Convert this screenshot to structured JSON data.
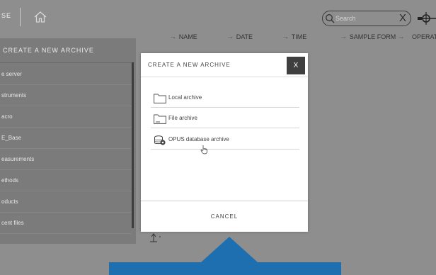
{
  "topbar": {
    "brand_fragment": "SE",
    "search_placeholder": "Search",
    "clear_label": "X"
  },
  "columns": [
    {
      "label": "NAME"
    },
    {
      "label": "DATE"
    },
    {
      "label": "TIME"
    },
    {
      "label": "SAMPLE FORM"
    },
    {
      "label": "OPERATI"
    }
  ],
  "panel": {
    "title": "CREATE A NEW ARCHIVE",
    "items": [
      {
        "label": "e server"
      },
      {
        "label": "struments"
      },
      {
        "label": "acro"
      },
      {
        "label": "E_Base"
      },
      {
        "label": "easurements"
      },
      {
        "label": "ethods"
      },
      {
        "label": "oducts"
      },
      {
        "label": "cent files"
      }
    ]
  },
  "modal": {
    "title": "CREATE A NEW ARCHIVE",
    "close_label": "X",
    "options": [
      {
        "label": "Local archive",
        "icon": "folder-icon"
      },
      {
        "label": "File archive",
        "icon": "file-archive-icon"
      },
      {
        "label": "OPUS database archive",
        "icon": "database-archive-icon"
      }
    ],
    "cancel_label": "CANCEL"
  },
  "colors": {
    "overlay_background": "#8e8e8e",
    "side_panel": "#7b7b7b",
    "close_button": "#3f3f3f",
    "callout_blue": "#1e6fb0"
  }
}
